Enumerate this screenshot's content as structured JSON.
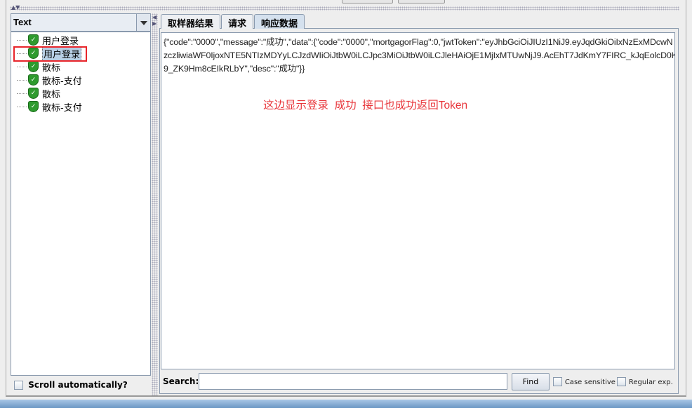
{
  "renderer_combo": {
    "value": "Text"
  },
  "tree": {
    "items": [
      {
        "label": "用户登录",
        "status": "success",
        "selected": false
      },
      {
        "label": "用户登录",
        "status": "success",
        "selected": true
      },
      {
        "label": "散标",
        "status": "success",
        "selected": false
      },
      {
        "label": "散标-支付",
        "status": "success",
        "selected": false
      },
      {
        "label": "散标",
        "status": "success",
        "selected": false
      },
      {
        "label": "散标-支付",
        "status": "success",
        "selected": false
      }
    ]
  },
  "scroll_automatically": {
    "label": "Scroll automatically?",
    "checked": false
  },
  "tabs": [
    {
      "label": "取样器结果"
    },
    {
      "label": "请求"
    },
    {
      "label": "响应数据",
      "active": true
    }
  ],
  "response": {
    "lines": [
      "{\"code\":\"0000\",\"message\":\"成功\",\"data\":{\"code\":\"0000\",\"mortgagorFlag\":0,\"jwtToken\":\"eyJhbGciOiJIUzI1NiJ9.eyJqdGkiOiIxNzExMDcwN",
      "zczliwiaWF0IjoxNTE5NTIzMDYyLCJzdWIiOiJtbW0iLCJpc3MiOiJtbW0iLCJleHAiOjE1MjIxMTUwNjJ9.AcEhT7JdKmY7FIRC_kJqEolcD0K",
      "9_ZK9Hm8cEIkRLbY\",\"desc\":\"成功\"}}"
    ]
  },
  "annotation": "这边显示登录  成功  接口也成功返回Token",
  "annotation_color": "#e8353a",
  "search": {
    "label": "Search:",
    "value": "",
    "find_label": "Find",
    "case_sensitive": "Case sensitive",
    "regular_exp": "Regular exp."
  }
}
